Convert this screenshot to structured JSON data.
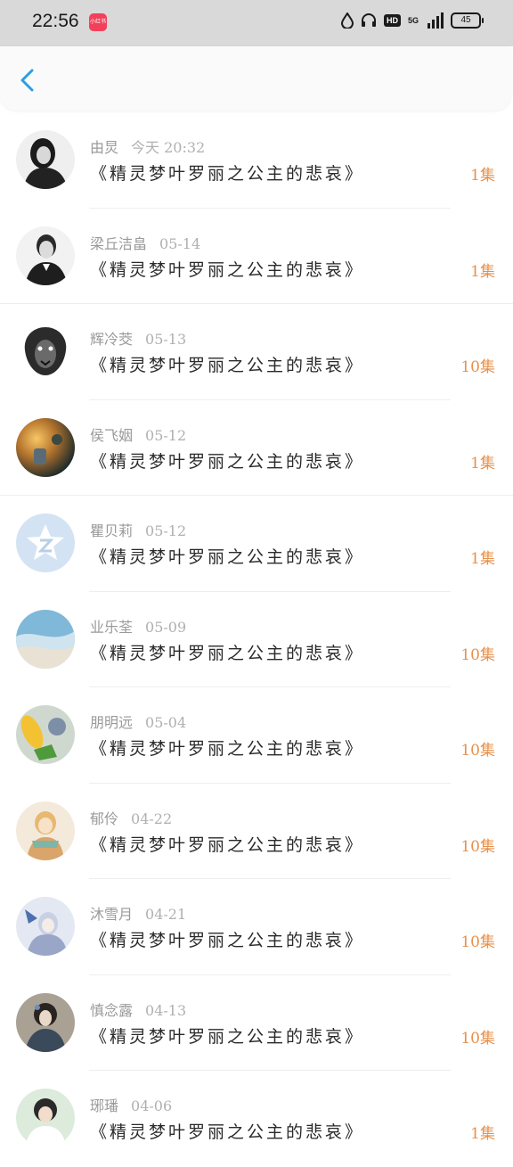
{
  "status_bar": {
    "time": "22:56",
    "app_badge": "小红书",
    "hd": "HD",
    "network": "5G",
    "battery": "45"
  },
  "header": {
    "back_icon": "chevron-left-icon",
    "accent": "#2b9fe0"
  },
  "list": {
    "count_color": "#e8904a",
    "items": [
      {
        "name": "由炅",
        "date": "今天 20:32",
        "title": "《精灵梦叶罗丽之公主的悲哀》",
        "count": "1集"
      },
      {
        "name": "梁丘洁畠",
        "date": "05-14",
        "title": "《精灵梦叶罗丽之公主的悲哀》",
        "count": "1集"
      },
      {
        "name": "辉冷茭",
        "date": "05-13",
        "title": "《精灵梦叶罗丽之公主的悲哀》",
        "count": "10集"
      },
      {
        "name": "侯飞姻",
        "date": "05-12",
        "title": "《精灵梦叶罗丽之公主的悲哀》",
        "count": "1集"
      },
      {
        "name": "瞿贝莉",
        "date": "05-12",
        "title": "《精灵梦叶罗丽之公主的悲哀》",
        "count": "1集"
      },
      {
        "name": "业乐荃",
        "date": "05-09",
        "title": "《精灵梦叶罗丽之公主的悲哀》",
        "count": "10集"
      },
      {
        "name": "朋明远",
        "date": "05-04",
        "title": "《精灵梦叶罗丽之公主的悲哀》",
        "count": "10集"
      },
      {
        "name": "郁伶",
        "date": "04-22",
        "title": "《精灵梦叶罗丽之公主的悲哀》",
        "count": "10集"
      },
      {
        "name": "沐雪月",
        "date": "04-21",
        "title": "《精灵梦叶罗丽之公主的悲哀》",
        "count": "10集"
      },
      {
        "name": "慎念露",
        "date": "04-13",
        "title": "《精灵梦叶罗丽之公主的悲哀》",
        "count": "10集"
      },
      {
        "name": "琊璠",
        "date": "04-06",
        "title": "《精灵梦叶罗丽之公主的悲哀》",
        "count": "1集"
      }
    ]
  }
}
